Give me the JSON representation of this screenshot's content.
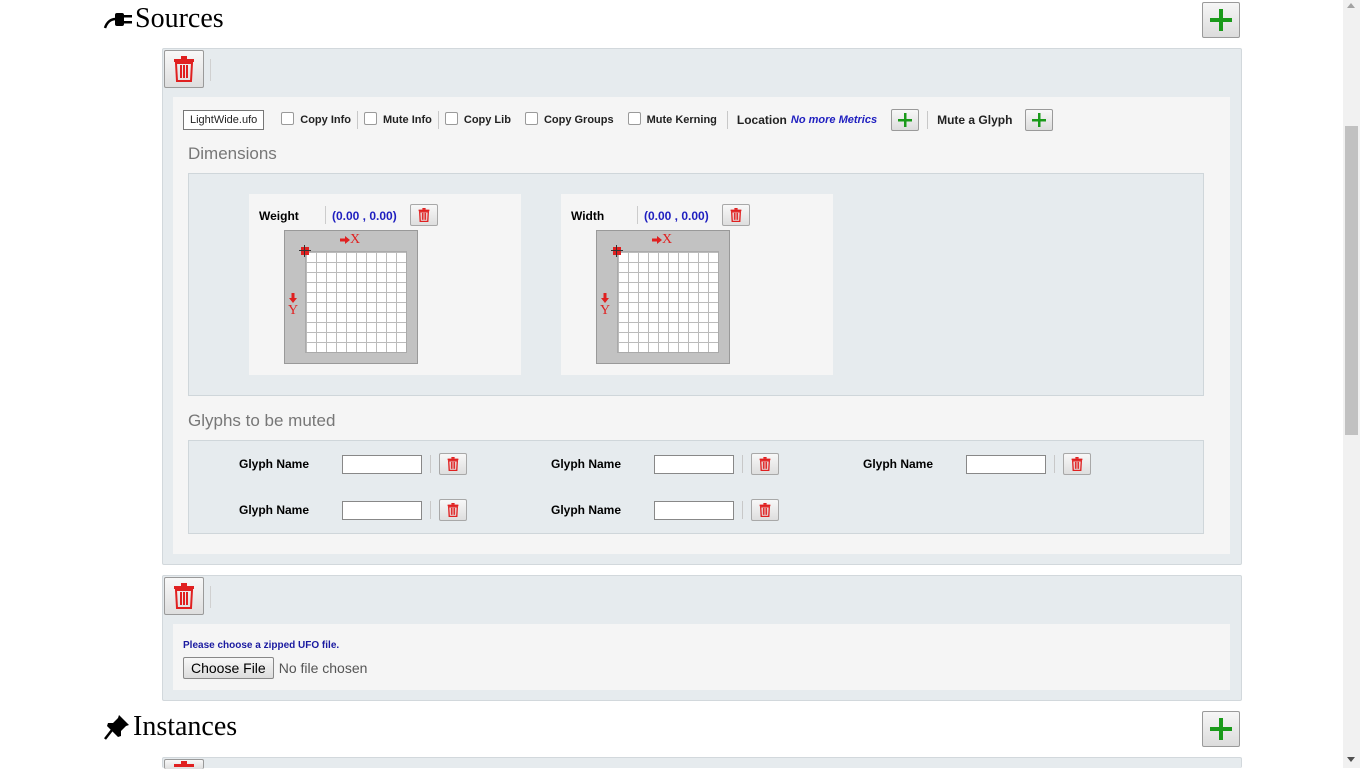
{
  "sources": {
    "title": "Sources",
    "source1": {
      "ufo_file": "LightWide.ufo",
      "options": [
        "Copy Info",
        "Mute Info",
        "Copy Lib",
        "Copy Groups",
        "Mute Kerning"
      ],
      "location_label": "Location",
      "location_note": "No more Metrics",
      "mute_glyph_label": "Mute a Glyph",
      "dimensions_title": "Dimensions",
      "axes": [
        {
          "name": "Weight",
          "coord": "(0.00 , 0.00)",
          "x_label": "X",
          "y_label": "Y"
        },
        {
          "name": "Width",
          "coord": "(0.00 , 0.00)",
          "x_label": "X",
          "y_label": "Y"
        }
      ],
      "glyphs_title": "Glyphs to be muted",
      "glyph_label": "Glyph Name",
      "glyph_count": 5
    },
    "source2": {
      "note": "Please choose a zipped UFO file.",
      "choose_file_label": "Choose File",
      "file_status": "No file chosen"
    }
  },
  "instances": {
    "title": "Instances"
  },
  "colors": {
    "add_green": "#1a9a1a",
    "trash_red": "#e02020",
    "coord_blue": "#2020c0"
  },
  "icons": [
    "plug-icon",
    "pushpin-icon",
    "plus-icon",
    "trash-icon",
    "arrow-right-icon",
    "arrow-down-icon"
  ]
}
